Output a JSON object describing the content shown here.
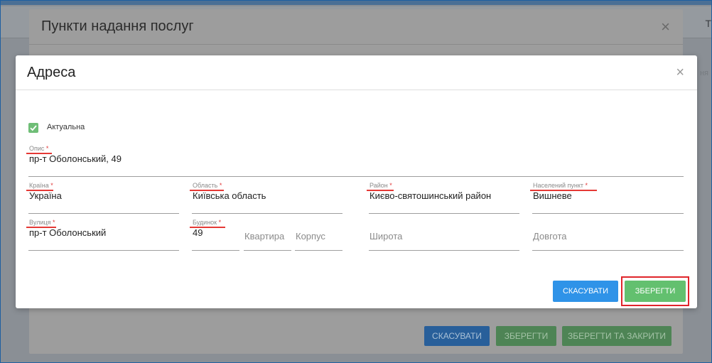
{
  "background": {
    "right_letter": "T",
    "right_text": "ня"
  },
  "modal_outer": {
    "title": "Пункти надання послуг",
    "close": "×",
    "buttons": {
      "cancel": "СКАСУВАТИ",
      "save": "ЗБЕРЕГТИ",
      "save_close": "ЗБЕРЕГТИ ТА ЗАКРИТИ"
    }
  },
  "modal_address": {
    "title": "Адреса",
    "close": "×",
    "actual_checkbox": {
      "label": "Актуальна",
      "checked": true
    },
    "fields": {
      "description": {
        "label": "Опис",
        "value": "пр-т Оболонський, 49"
      },
      "country": {
        "label": "Країна",
        "value": "Україна"
      },
      "region": {
        "label": "Область",
        "value": "Київська область"
      },
      "district": {
        "label": "Район",
        "value": "Києво-святошинський район"
      },
      "settlement": {
        "label": "Населений пункт",
        "value": "Вишневе"
      },
      "street": {
        "label": "Вулиця",
        "value": "пр-т Оболонський"
      },
      "house": {
        "label": "Будинок",
        "value": "49"
      },
      "apartment": {
        "placeholder": "Квартира"
      },
      "building": {
        "placeholder": "Корпус"
      },
      "latitude": {
        "placeholder": "Широта"
      },
      "longitude": {
        "placeholder": "Довгота"
      }
    },
    "required_mark": "*",
    "buttons": {
      "cancel": "СКАСУВАТИ",
      "save": "ЗБЕРЕГТИ"
    }
  },
  "colors": {
    "primary": "#2f93e8",
    "success": "#63c06f",
    "required": "#e53935"
  }
}
